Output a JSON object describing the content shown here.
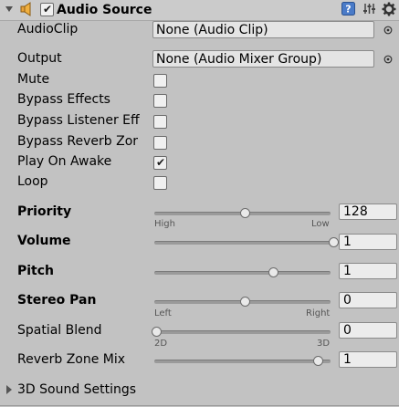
{
  "header": {
    "title": "Audio Source",
    "enabled": true
  },
  "fields": {
    "audio_clip": {
      "label": "AudioClip",
      "value": "None (Audio Clip)"
    },
    "output": {
      "label": "Output",
      "value": "None (Audio Mixer Group)"
    }
  },
  "toggles": [
    {
      "label": "Mute",
      "checked": false
    },
    {
      "label": "Bypass Effects",
      "checked": false
    },
    {
      "label": "Bypass Listener Eff",
      "checked": false
    },
    {
      "label": "Bypass Reverb Zor",
      "checked": false
    },
    {
      "label": "Play On Awake",
      "checked": true
    },
    {
      "label": "Loop",
      "checked": false
    }
  ],
  "sliders": {
    "priority": {
      "label": "Priority",
      "value": "128",
      "min_label": "High",
      "max_label": "Low",
      "fraction": 0.5
    },
    "volume": {
      "label": "Volume",
      "value": "1",
      "fraction": 1.0
    },
    "pitch": {
      "label": "Pitch",
      "value": "1",
      "fraction": 0.66
    },
    "stereo_pan": {
      "label": "Stereo Pan",
      "value": "0",
      "min_label": "Left",
      "max_label": "Right",
      "fraction": 0.5
    },
    "spatial_blend": {
      "label": "Spatial Blend",
      "value": "0",
      "min_label": "2D",
      "max_label": "3D",
      "fraction": 0.0
    },
    "reverb_zone_mix": {
      "label": "Reverb Zone Mix",
      "value": "1",
      "fraction": 0.91
    }
  },
  "foldout": {
    "label": "3D Sound Settings",
    "expanded": false
  },
  "check_glyph": "✔",
  "icons": [
    "foldout-arrow-icon",
    "audio-source-icon",
    "help-icon",
    "preset-icon",
    "gear-icon",
    "object-picker-icon"
  ]
}
